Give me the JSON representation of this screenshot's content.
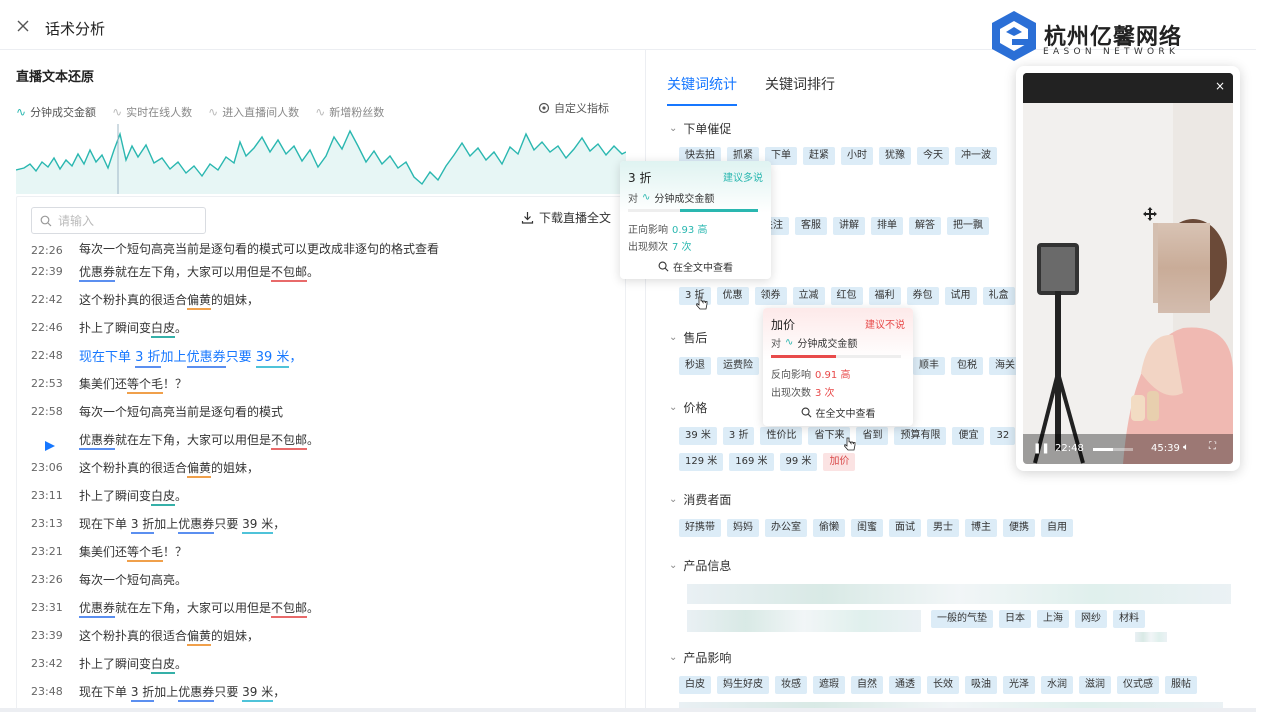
{
  "header": {
    "title": "话术分析"
  },
  "logo": {
    "cn": "杭州亿馨网络",
    "en": "EASON NETWORK"
  },
  "left": {
    "section_title": "直播文本还原",
    "metrics": [
      "分钟成交金额",
      "实时在线人数",
      "进入直播间人数",
      "新增粉丝数"
    ],
    "custom_indicator": "自定义指标",
    "search_placeholder": "请输入",
    "download_label": "下载直播全文"
  },
  "transcript": [
    {
      "time": "22:26",
      "text": "每次一个短句高亮当前是逐句看的模式可以更改成非逐句的格式查看"
    },
    {
      "time": "22:39",
      "text": "优惠券就在左下角，大家可以用但是不包邮。"
    },
    {
      "time": "22:42",
      "text": "这个粉扑真的很适合偏黄的姐妹，"
    },
    {
      "time": "22:46",
      "text": "扑上了瞬间变白皮。"
    },
    {
      "time": "22:48",
      "text": "现在下单 3 折加上优惠券只要 39 米，"
    },
    {
      "time": "22:53",
      "text": "集美们还等个毛！？"
    },
    {
      "time": "22:58",
      "text": "每次一个短句高亮当前是逐句看的模式"
    },
    {
      "time": "",
      "text": "优惠券就在左下角，大家可以用但是不包邮。"
    },
    {
      "time": "23:06",
      "text": "这个粉扑真的很适合偏黄的姐妹，"
    },
    {
      "time": "23:11",
      "text": "扑上了瞬间变白皮。"
    },
    {
      "time": "23:13",
      "text": "现在下单 3 折加上优惠券只要 39 米，"
    },
    {
      "time": "23:21",
      "text": "集美们还等个毛！？"
    },
    {
      "time": "23:26",
      "text": "每次一个短句高亮。"
    },
    {
      "time": "23:31",
      "text": "优惠券就在左下角，大家可以用但是不包邮。"
    },
    {
      "time": "23:39",
      "text": "这个粉扑真的很适合偏黄的姐妹，"
    },
    {
      "time": "23:42",
      "text": "扑上了瞬间变白皮。"
    },
    {
      "time": "23:48",
      "text": "现在下单 3 折加上优惠券只要 39 米，"
    }
  ],
  "right": {
    "tabs": [
      "关键词统计",
      "关键词排行"
    ],
    "groups": {
      "order": {
        "title": "下单催促",
        "tags": [
          "快去拍",
          "抓紧",
          "下单",
          "赶紧",
          "小时",
          "犹豫",
          "今天",
          "冲一波"
        ]
      },
      "service": {
        "tags": [
          "关注",
          "客服",
          "讲解",
          "排单",
          "解答",
          "把一飘"
        ]
      },
      "promo": {
        "tags": [
          "3 折",
          "优惠",
          "领券",
          "立减",
          "红包",
          "福利",
          "券包",
          "试用",
          "礼盒"
        ]
      },
      "after": {
        "title": "售后",
        "tags": [
          "秒退",
          "运费险",
          "顺丰",
          "包税",
          "海关"
        ]
      },
      "price": {
        "title": "价格",
        "tags1": [
          "39 米",
          "3 折",
          "性价比",
          "省下来",
          "省到",
          "预算有限",
          "便宜",
          "32"
        ],
        "tags2": [
          "129 米",
          "169 米",
          "99 米",
          "加价"
        ]
      },
      "consumer": {
        "title": "消费者面",
        "tags": [
          "好携带",
          "妈妈",
          "办公室",
          "偷懒",
          "闺蜜",
          "面试",
          "男士",
          "博主",
          "便携",
          "自用"
        ]
      },
      "product": {
        "title": "产品信息",
        "tags": [
          "一般的气垫",
          "日本",
          "上海",
          "网纱",
          "材料"
        ]
      },
      "impact": {
        "title": "产品影响",
        "tags": [
          "白皮",
          "妈生好皮",
          "妆感",
          "遮瑕",
          "自然",
          "通透",
          "长效",
          "吸油",
          "光泽",
          "水润",
          "滋润",
          "仪式感",
          "服帖"
        ]
      }
    }
  },
  "popup_a": {
    "title": "3 折",
    "tip": "建议多说",
    "metric_prefix": "对",
    "metric": "分钟成交金额",
    "impact_label": "正向影响",
    "impact_value": "0.93 高",
    "count_label": "出现频次",
    "count_value": "7 次",
    "link": "在全文中查看",
    "fill": 0.6,
    "color": "#2ab7b0"
  },
  "popup_b": {
    "title": "加价",
    "tip": "建议不说",
    "metric_prefix": "对",
    "metric": "分钟成交金额",
    "impact_label": "反向影响",
    "impact_value": "0.91 高",
    "count_label": "出现次数",
    "count_value": "3 次",
    "link": "在全文中查看",
    "fill": 0.5,
    "color": "#e84a4a"
  },
  "video": {
    "current": "22:48",
    "total": "45:39",
    "progress": 0.5
  }
}
